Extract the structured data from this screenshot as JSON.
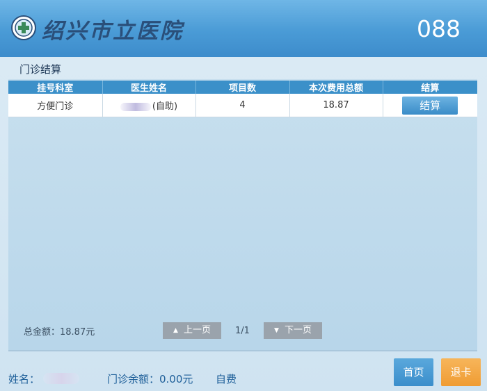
{
  "header": {
    "logo_icon": "hospital-emblem-icon",
    "logo_text": "绍兴市立医院",
    "queue_number": "088"
  },
  "section": {
    "title": "门诊结算"
  },
  "table": {
    "columns": [
      "挂号科室",
      "医生姓名",
      "项目数",
      "本次费用总额",
      "结算"
    ],
    "rows": [
      {
        "department": "方便门诊",
        "doctor_suffix": "(自助)",
        "item_count": "4",
        "total_fee": "18.87",
        "action_label": "结算"
      }
    ]
  },
  "summary": {
    "total_label": "总金额：18.87元"
  },
  "pagination": {
    "prev_label": "上一页",
    "next_label": "下一页",
    "page_indicator": "1/1",
    "prev_icon": "triangle-up-icon",
    "next_icon": "triangle-down-icon"
  },
  "footer": {
    "name_label": "姓名：",
    "balance_label": "门诊余额：0.00元",
    "payment_type": "自费",
    "home_label": "首页",
    "exit_label": "退卡"
  },
  "colors": {
    "header_blue": "#4a9bd6",
    "table_header": "#3b90c9",
    "home_button": "#3b8ecb",
    "exit_button": "#ef9c33"
  }
}
